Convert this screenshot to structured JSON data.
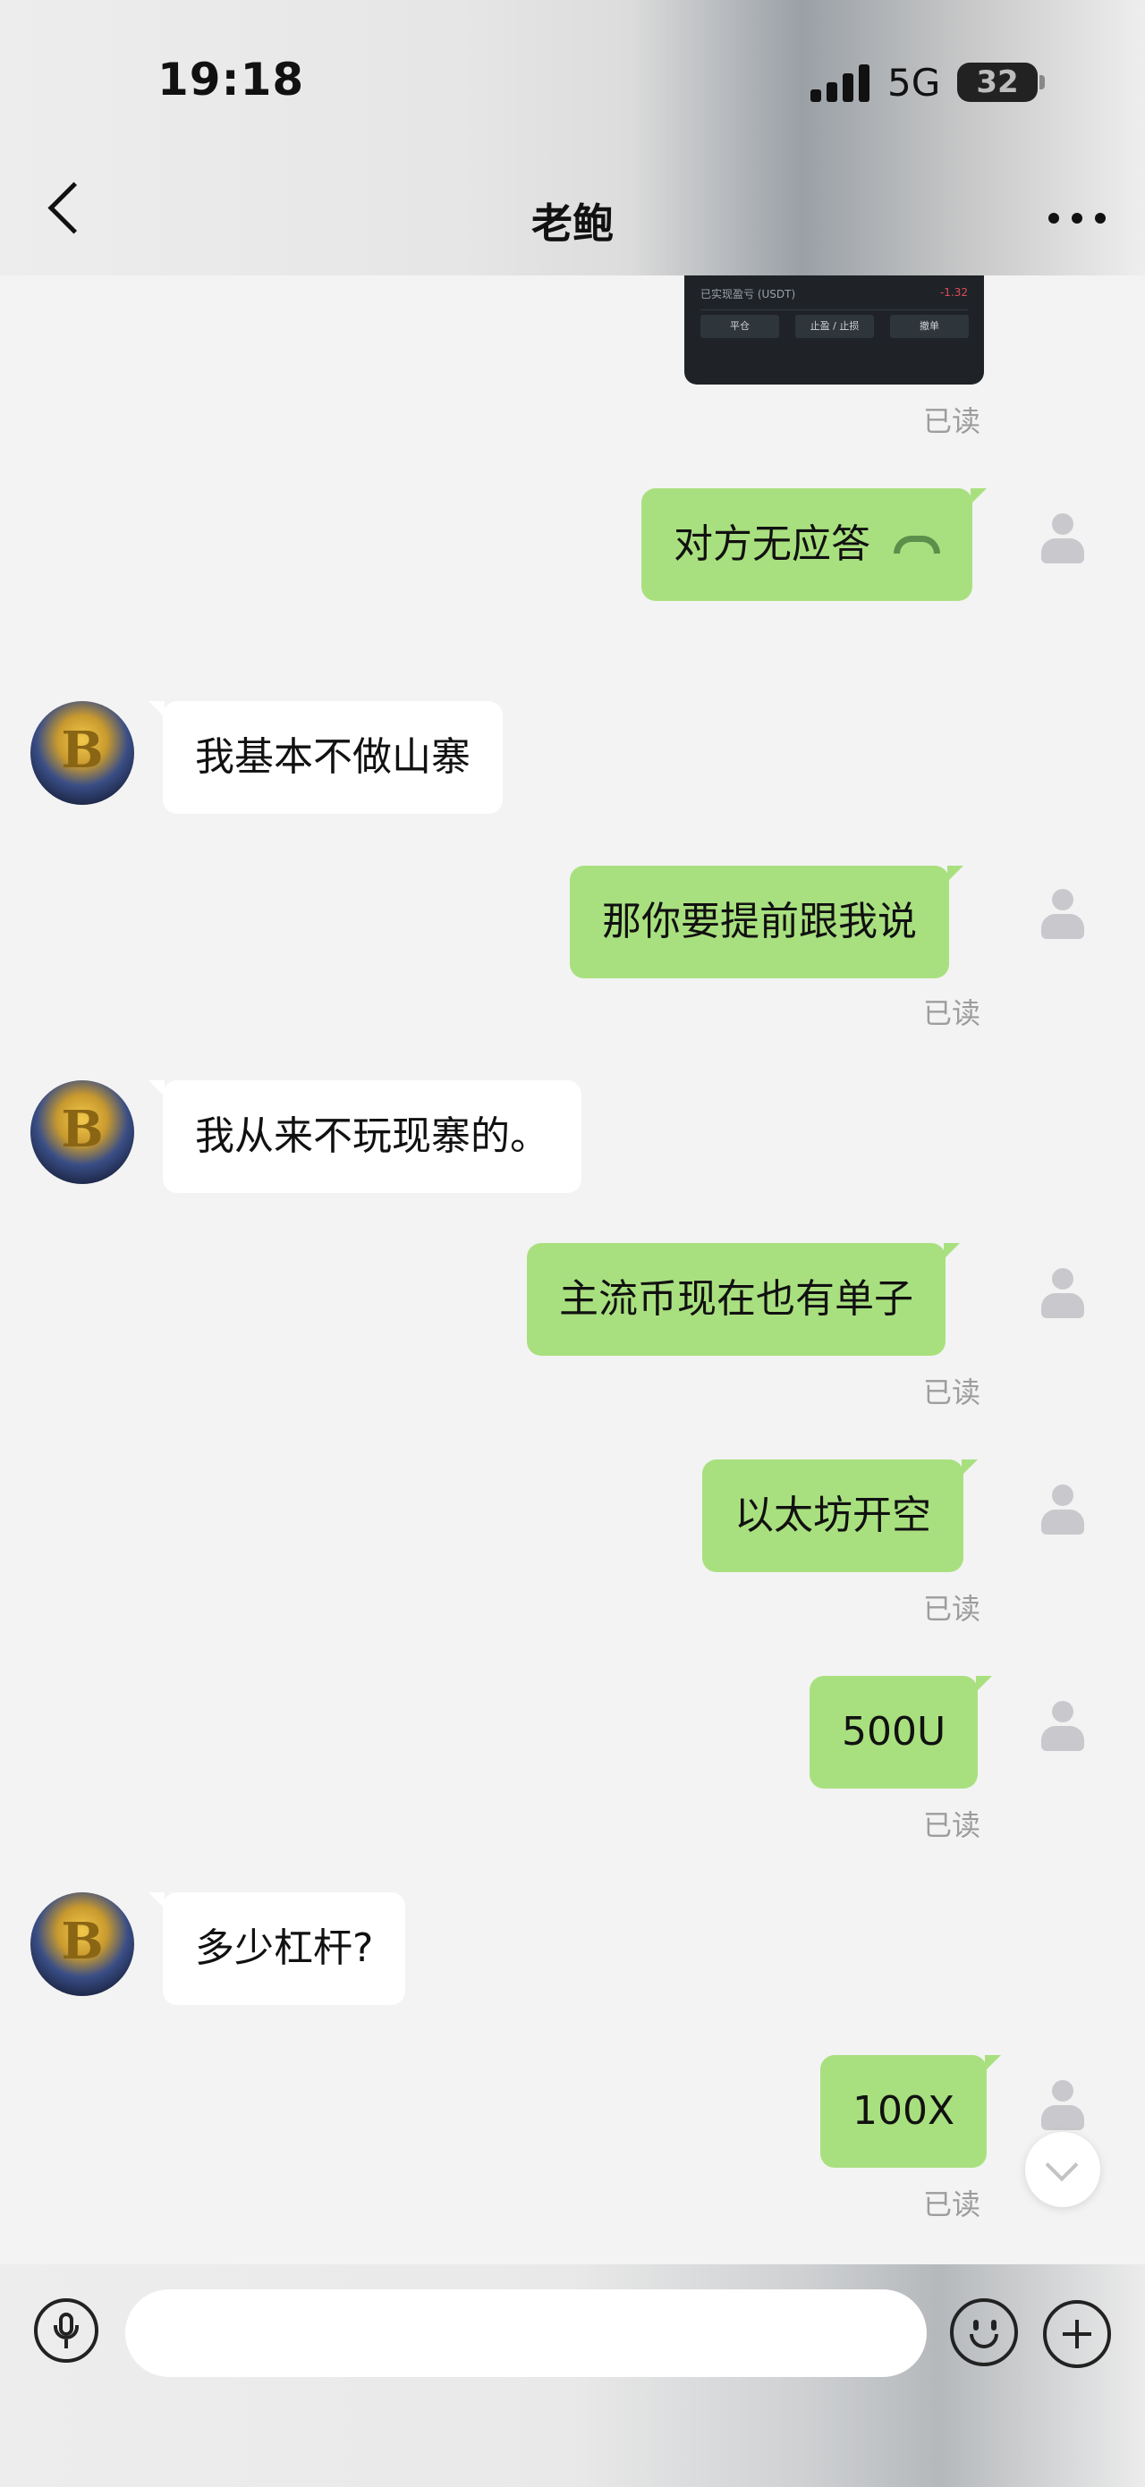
{
  "status_bar": {
    "time": "19:18",
    "network": "5G",
    "battery": "32"
  },
  "header": {
    "title": "老鲍"
  },
  "trade_card": {
    "row_text": "已实现盈亏 (USDT)",
    "row_value": "-1.32",
    "buttons": [
      "平仓",
      "止盈 / 止损",
      "撤单"
    ]
  },
  "read_label": "已读",
  "messages": [
    {
      "side": "me",
      "text": "对方无应答",
      "icon": "phone-hangup-icon"
    },
    {
      "side": "them",
      "text": "我基本不做山寨"
    },
    {
      "side": "me",
      "text": "那你要提前跟我说"
    },
    {
      "side": "them",
      "text": "我从来不玩现寨的。"
    },
    {
      "side": "me",
      "text": "主流币现在也有单子"
    },
    {
      "side": "me",
      "text": "以太坊开空"
    },
    {
      "side": "me",
      "text": "500U"
    },
    {
      "side": "them",
      "text": "多少杠杆?"
    },
    {
      "side": "me",
      "text": "100X"
    }
  ],
  "input": {
    "value": "",
    "placeholder": ""
  },
  "icons": {
    "back": "back-chevron-icon",
    "more": "more-dots-icon",
    "mic": "microphone-icon",
    "emoji": "emoji-icon",
    "plus": "plus-icon",
    "scroll": "chevron-down-icon"
  },
  "colors": {
    "my_bubble": "#a9e07f",
    "their_bubble": "#ffffff",
    "background": "#f3f3f3"
  }
}
